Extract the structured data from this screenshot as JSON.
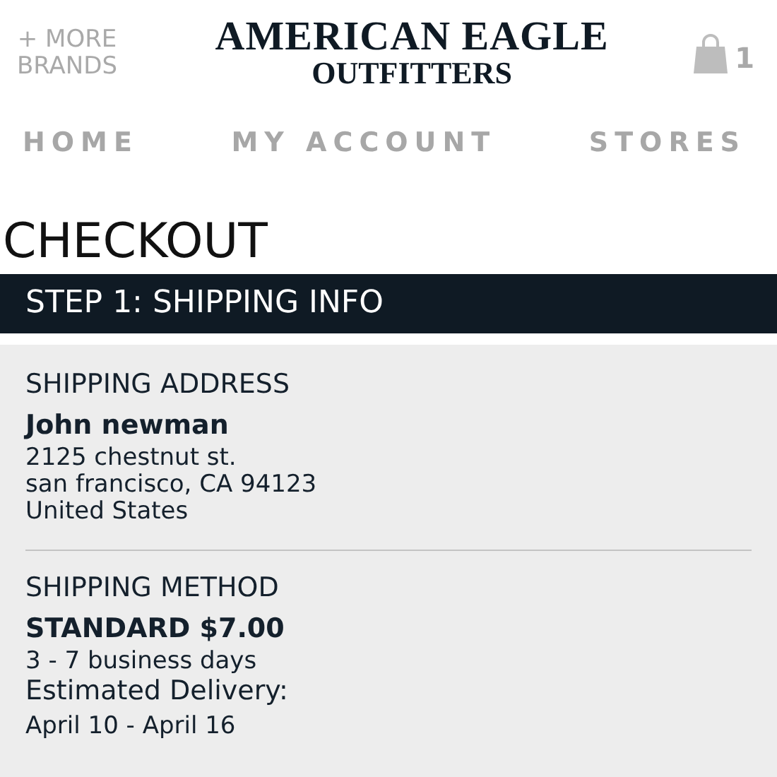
{
  "header": {
    "more_brands": "+ MORE\nBRANDS",
    "logo_top": "AMERICAN EAGLE",
    "logo_bottom": "OUTFITTERS",
    "bag_count": "1"
  },
  "nav": [
    "HOME",
    "MY ACCOUNT",
    "STORES"
  ],
  "page_title": "CHECKOUT",
  "step_bar": "STEP 1: SHIPPING INFO",
  "sections": [
    {
      "heading": "SHIPPING ADDRESS",
      "primary": "John newman",
      "lines": [
        "2125 chestnut st.",
        "san francisco, CA 94123",
        "United States"
      ]
    },
    {
      "heading": "SHIPPING METHOD",
      "primary": "STANDARD $7.00",
      "lines": [
        "3 - 7 business days"
      ],
      "delivery_label": "Estimated Delivery:",
      "delivery_dates": "April 10 - April 16"
    }
  ]
}
